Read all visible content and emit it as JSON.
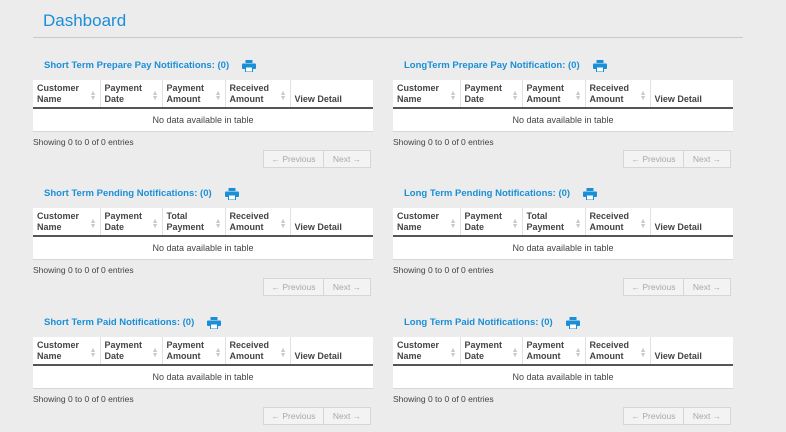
{
  "page": {
    "title": "Dashboard"
  },
  "panels": [
    {
      "title": "Short Term Prepare Pay Notifications: (0)",
      "headers": [
        "Customer Name",
        "Payment Date",
        "Payment Amount",
        "Received Amount",
        "View Detail"
      ],
      "empty": "No data available in table",
      "info": "Showing 0 to 0 of 0 entries",
      "prev": "← Previous",
      "next": "Next →"
    },
    {
      "title": "LongTerm Prepare Pay Notification: (0)",
      "headers": [
        "Customer Name",
        "Payment Date",
        "Payment Amount",
        "Received Amount",
        "View Detail"
      ],
      "empty": "No data available in table",
      "info": "Showing 0 to 0 of 0 entries",
      "prev": "← Previous",
      "next": "Next →"
    },
    {
      "title": "Short Term Pending Notifications: (0)",
      "headers": [
        "Customer Name",
        "Payment Date",
        "Total Payment",
        "Received Amount",
        "View Detail"
      ],
      "empty": "No data available in table",
      "info": "Showing 0 to 0 of 0 entries",
      "prev": "← Previous",
      "next": "Next →"
    },
    {
      "title": "Long Term Pending Notifications: (0)",
      "headers": [
        "Customer Name",
        "Payment Date",
        "Total Payment",
        "Received Amount",
        "View Detail"
      ],
      "empty": "No data available in table",
      "info": "Showing 0 to 0 of 0 entries",
      "prev": "← Previous",
      "next": "Next →"
    },
    {
      "title": "Short Term Paid Notifications: (0)",
      "headers": [
        "Customer Name",
        "Payment Date",
        "Payment Amount",
        "Received Amount",
        "View Detail"
      ],
      "empty": "No data available in table",
      "info": "Showing 0 to 0 of 0 entries",
      "prev": "← Previous",
      "next": "Next →"
    },
    {
      "title": "Long Term Paid Notifications: (0)",
      "headers": [
        "Customer Name",
        "Payment Date",
        "Payment Amount",
        "Received Amount",
        "View Detail"
      ],
      "empty": "No data available in table",
      "info": "Showing 0 to 0 of 0 entries",
      "prev": "← Previous",
      "next": "Next →"
    }
  ],
  "icons": {
    "print": "printer-icon"
  },
  "colors": {
    "accent": "#1a8fd8",
    "background": "#ececec"
  }
}
